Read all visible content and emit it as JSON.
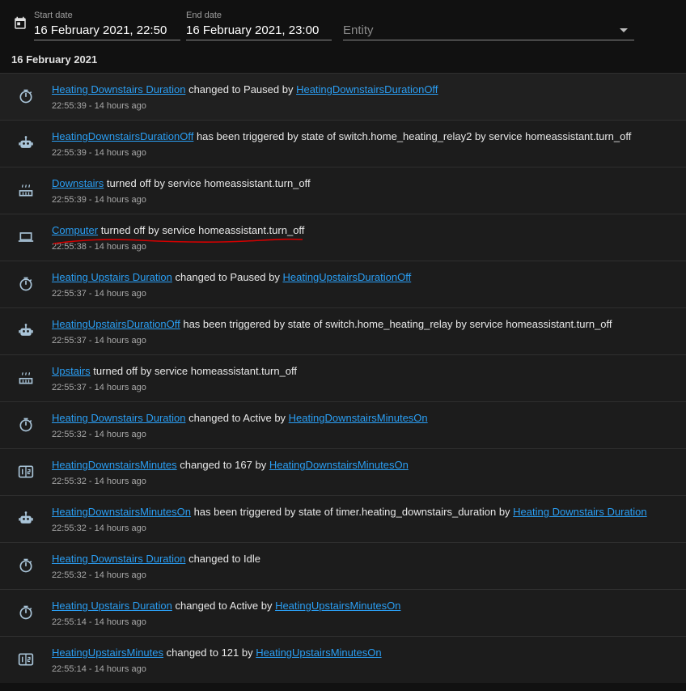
{
  "header": {
    "start_label": "Start date",
    "start_value": "16 February 2021, 22:50",
    "end_label": "End date",
    "end_value": "16 February 2021, 23:00",
    "entity_placeholder": "Entity"
  },
  "date_heading": "16 February 2021",
  "colors": {
    "background": "#111111",
    "row": "#1c1c1c",
    "link": "#2a9ef3",
    "annotation": "#d50000"
  },
  "entries": [
    {
      "icon": "timer-icon",
      "parts": [
        {
          "t": "Heating Downstairs Duration",
          "link": true
        },
        {
          "t": " changed to Paused by "
        },
        {
          "t": "HeatingDownstairsDurationOff",
          "link": true
        }
      ],
      "time": "22:55:39 - 14 hours ago"
    },
    {
      "icon": "robot-icon",
      "parts": [
        {
          "t": "HeatingDownstairsDurationOff",
          "link": true
        },
        {
          "t": " has been triggered by state of switch.home_heating_relay2 by service homeassistant.turn_off"
        }
      ],
      "time": "22:55:39 - 14 hours ago"
    },
    {
      "icon": "radiator-icon",
      "parts": [
        {
          "t": "Downstairs",
          "link": true
        },
        {
          "t": " turned off by service homeassistant.turn_off"
        }
      ],
      "time": "22:55:39 - 14 hours ago"
    },
    {
      "icon": "laptop-icon",
      "parts": [
        {
          "t": "Computer",
          "link": true
        },
        {
          "t": " turned off by service homeassistant.turn_off"
        }
      ],
      "time": "22:55:38 - 14 hours ago",
      "annotated": true
    },
    {
      "icon": "timer-icon",
      "parts": [
        {
          "t": "Heating Upstairs Duration",
          "link": true
        },
        {
          "t": " changed to Paused by "
        },
        {
          "t": "HeatingUpstairsDurationOff",
          "link": true
        }
      ],
      "time": "22:55:37 - 14 hours ago"
    },
    {
      "icon": "robot-icon",
      "parts": [
        {
          "t": "HeatingUpstairsDurationOff",
          "link": true
        },
        {
          "t": " has been triggered by state of switch.home_heating_relay by service homeassistant.turn_off"
        }
      ],
      "time": "22:55:37 - 14 hours ago"
    },
    {
      "icon": "radiator-icon",
      "parts": [
        {
          "t": "Upstairs",
          "link": true
        },
        {
          "t": " turned off by service homeassistant.turn_off"
        }
      ],
      "time": "22:55:37 - 14 hours ago"
    },
    {
      "icon": "timer-icon",
      "parts": [
        {
          "t": "Heating Downstairs Duration",
          "link": true
        },
        {
          "t": " changed to Active by "
        },
        {
          "t": "HeatingDownstairsMinutesOn",
          "link": true
        }
      ],
      "time": "22:55:32 - 14 hours ago"
    },
    {
      "icon": "counter-icon",
      "parts": [
        {
          "t": "HeatingDownstairsMinutes",
          "link": true
        },
        {
          "t": " changed to 167 by "
        },
        {
          "t": "HeatingDownstairsMinutesOn",
          "link": true
        }
      ],
      "time": "22:55:32 - 14 hours ago"
    },
    {
      "icon": "robot-icon",
      "parts": [
        {
          "t": "HeatingDownstairsMinutesOn",
          "link": true
        },
        {
          "t": " has been triggered by state of timer.heating_downstairs_duration by "
        },
        {
          "t": "Heating Downstairs Duration",
          "link": true
        }
      ],
      "time": "22:55:32 - 14 hours ago"
    },
    {
      "icon": "timer-icon",
      "parts": [
        {
          "t": "Heating Downstairs Duration",
          "link": true
        },
        {
          "t": " changed to Idle"
        }
      ],
      "time": "22:55:32 - 14 hours ago"
    },
    {
      "icon": "timer-icon",
      "parts": [
        {
          "t": "Heating Upstairs Duration",
          "link": true
        },
        {
          "t": " changed to Active by "
        },
        {
          "t": "HeatingUpstairsMinutesOn",
          "link": true
        }
      ],
      "time": "22:55:14 - 14 hours ago"
    },
    {
      "icon": "counter-icon",
      "parts": [
        {
          "t": "HeatingUpstairsMinutes",
          "link": true
        },
        {
          "t": " changed to 121 by "
        },
        {
          "t": "HeatingUpstairsMinutesOn",
          "link": true
        }
      ],
      "time": "22:55:14 - 14 hours ago"
    }
  ]
}
